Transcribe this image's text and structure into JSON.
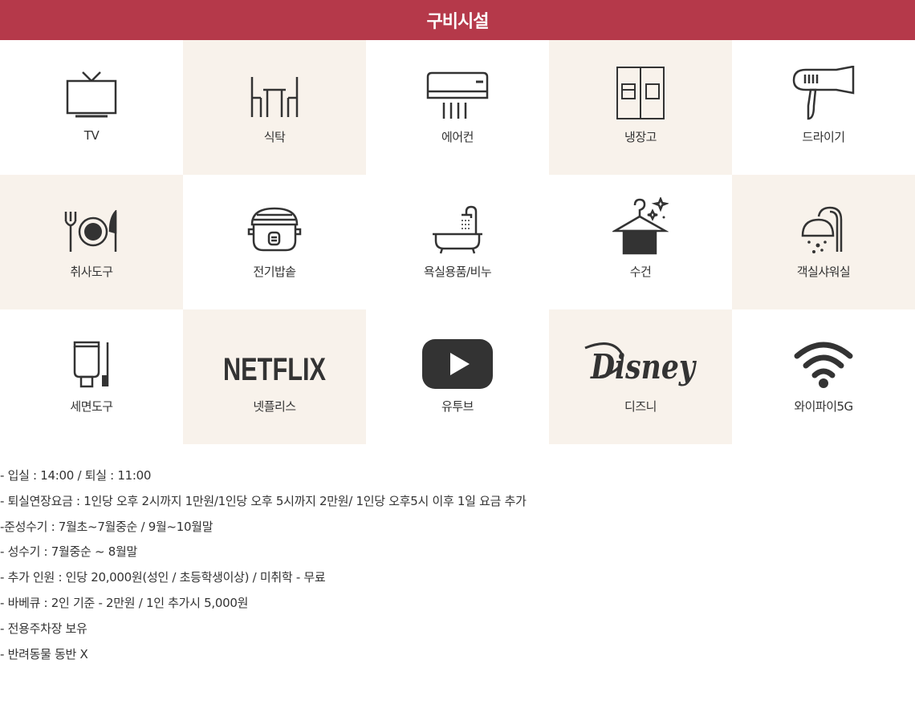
{
  "header": {
    "title": "구비시설"
  },
  "amenities": [
    {
      "label": "TV",
      "icon": "tv-icon"
    },
    {
      "label": "식탁",
      "icon": "dining-table-icon"
    },
    {
      "label": "에어컨",
      "icon": "air-conditioner-icon"
    },
    {
      "label": "냉장고",
      "icon": "refrigerator-icon"
    },
    {
      "label": "드라이기",
      "icon": "hair-dryer-icon"
    },
    {
      "label": "취사도구",
      "icon": "cookware-icon"
    },
    {
      "label": "전기밥솥",
      "icon": "rice-cooker-icon"
    },
    {
      "label": "욕실용품/비누",
      "icon": "bathtub-icon"
    },
    {
      "label": "수건",
      "icon": "towel-icon"
    },
    {
      "label": "객실샤워실",
      "icon": "shower-icon"
    },
    {
      "label": "세면도구",
      "icon": "toiletries-icon"
    },
    {
      "label": "넷플리스",
      "icon": "netflix-logo",
      "logo_text": "NETFLIX"
    },
    {
      "label": "유투브",
      "icon": "youtube-icon"
    },
    {
      "label": "디즈니",
      "icon": "disney-logo",
      "logo_text": "Disney"
    },
    {
      "label": "와이파이5G",
      "icon": "wifi-icon"
    }
  ],
  "info": [
    "- 입실 : 14:00 / 퇴실 : 11:00",
    "- 퇴실연장요금 : 1인당 오후 2시까지 1만원/1인당 오후 5시까지 2만원/ 1인당 오후5시 이후 1일 요금 추가",
    "-준성수기 : 7월초~7월중순 / 9월~10월말",
    "- 성수기 : 7월중순 ~ 8월말",
    "- 추가 인원 : 인당 20,000원(성인 / 초등학생이상) / 미취학 - 무료",
    "- 바베큐 : 2인 기준 - 2만원 / 1인 추가시 5,000원",
    "- 전용주차장 보유",
    "- 반려동물 동반 X"
  ],
  "colors": {
    "header_bg": "#b5394a",
    "shade_bg": "#f8f2eb",
    "icon": "#333333"
  }
}
